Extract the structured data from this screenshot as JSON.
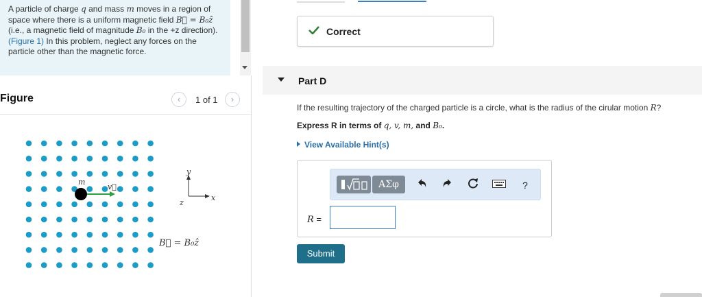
{
  "problem": {
    "s1": "A particle of charge ",
    "q": "q",
    "s2": " and mass ",
    "mass": "m",
    "s3": " moves in a region of space where there is a uniform magnetic field ",
    "field_eq": "B⃗ = B₀ẑ",
    "s4": " (i.e., a magnetic field of magnitude ",
    "b0": "B₀",
    "s5": " in the +z direction). ",
    "figure_link": "(Figure 1)",
    "s6": " In this problem, neglect any forces on the particle other than the magnetic force."
  },
  "figure": {
    "title": "Figure",
    "pager_label": "1 of 1",
    "prev_icon": "chevron-left-icon",
    "next_icon": "chevron-right-icon",
    "particle_label": "m",
    "velocity_label": "v⃗",
    "axis_y": "y",
    "axis_x": "x",
    "axis_z": "z",
    "field_label": "B⃗ = B₀ẑ",
    "dot_color": "#1d9bc7",
    "particle_color": "#000000",
    "velocity_color": "#2e9e3e"
  },
  "status": {
    "label": "Correct",
    "icon": "check-icon",
    "color": "#2e7d32"
  },
  "part": {
    "label": "Part D",
    "question_before": "If the resulting trajectory of the charged particle is a circle, what is the radius of the cirular motion ",
    "question_var": "R",
    "question_after": "?",
    "instruction_before": "Express R in terms of ",
    "instr_vars": "q, v, m,",
    "instruction_and": " and ",
    "instr_b0": "B₀",
    "instruction_end": ".",
    "hints_label": "View Available Hint(s)"
  },
  "answer": {
    "toolbar": {
      "templates_icon": "templates-icon",
      "greek_label": "ΑΣφ",
      "undo_icon": "undo-icon",
      "redo_icon": "redo-icon",
      "reset_icon": "reset-icon",
      "keyboard_icon": "keyboard-icon",
      "help_label": "?"
    },
    "variable": "R",
    "equals": " =",
    "value": ""
  },
  "submit_label": "Submit",
  "colors": {
    "accent": "#1f6f8b",
    "link": "#2a6fa8",
    "problem_bg": "#e8f4f8",
    "toolbar_bg": "#dde9f6"
  }
}
